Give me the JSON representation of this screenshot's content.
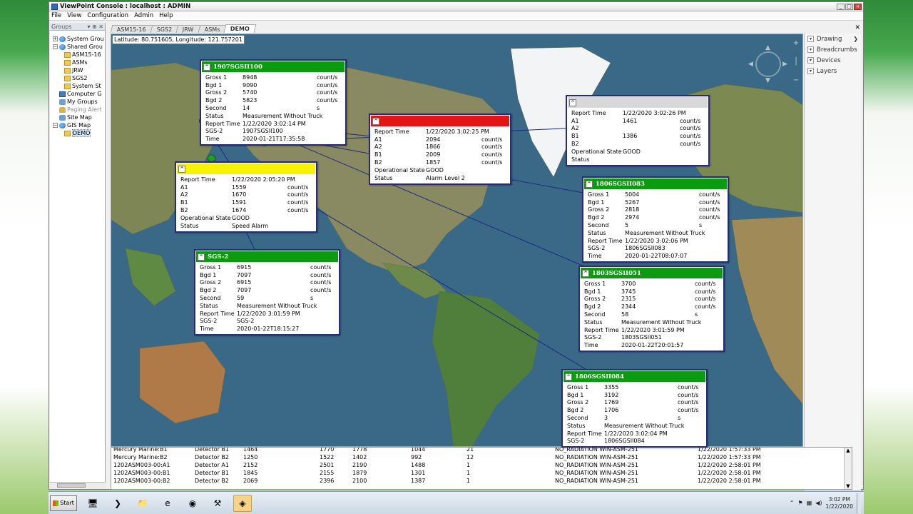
{
  "window": {
    "title": "ViewPoint Console : localhost : ADMIN"
  },
  "menu": [
    "File",
    "View",
    "Configuration",
    "Admin",
    "Help"
  ],
  "groups_panel": {
    "title": "Groups",
    "controls": "▾ ⊕ ✕",
    "items": [
      {
        "label": "System Grou",
        "icon": "globe-icon",
        "indent": 0,
        "expander": "+"
      },
      {
        "label": "Shared Grou",
        "icon": "globe-icon",
        "indent": 0,
        "expander": "−"
      },
      {
        "label": "ASM15-16",
        "icon": "folder-icon",
        "indent": 1
      },
      {
        "label": "ASMs",
        "icon": "folder-icon",
        "indent": 1
      },
      {
        "label": "JRW",
        "icon": "folder-icon",
        "indent": 1
      },
      {
        "label": "SGS2",
        "icon": "folder-icon",
        "indent": 1
      },
      {
        "label": "System St",
        "icon": "folder-icon",
        "indent": 1
      },
      {
        "label": "Computer G",
        "icon": "monitor-icon",
        "indent": 0
      },
      {
        "label": "My Groups",
        "icon": "groups-icon",
        "indent": 0
      },
      {
        "label": "Paging Alert",
        "icon": "bell-icon",
        "indent": 0,
        "dim": true
      },
      {
        "label": "Site Map",
        "icon": "groups-icon",
        "indent": 0
      },
      {
        "label": "GIS Map",
        "icon": "globe-icon",
        "indent": 0,
        "expander": "−"
      },
      {
        "label": "DEMO",
        "icon": "folder-icon",
        "indent": 1,
        "selected": true
      }
    ]
  },
  "tabs": [
    {
      "label": "ASM15-16"
    },
    {
      "label": "SGS2"
    },
    {
      "label": "JRW"
    },
    {
      "label": "ASMs"
    },
    {
      "label": "DEMO",
      "active": true
    }
  ],
  "tab_close": "✕",
  "map": {
    "coordinates": "Latitude: 80.751605, Longitude: 121.757201",
    "points": [
      {
        "lat": 47.5,
        "lon": -122.0
      },
      {
        "lat": 47.5,
        "lon": -112.0
      },
      {
        "lat": 45.5,
        "lon": -93.0
      },
      {
        "lat": 39.5,
        "lon": -90.0
      },
      {
        "lat": 40.5,
        "lon": -75.0
      },
      {
        "lat": 40.0,
        "lon": -77.0
      },
      {
        "lat": 33.5,
        "lon": -117.5
      },
      {
        "lat": 27.5,
        "lon": -93.0
      }
    ]
  },
  "popups": [
    {
      "id": "1907",
      "title": "1907SGSII100",
      "color": "green",
      "anchor": 2,
      "rows": [
        [
          "Gross 1",
          "8948",
          "count/s"
        ],
        [
          "Bgd 1",
          "9090",
          "count/s"
        ],
        [
          "Gross 2",
          "5740",
          "count/s"
        ],
        [
          "Bgd 2",
          "5823",
          "count/s"
        ],
        [
          "Second",
          "14",
          "s"
        ],
        [
          "Status",
          "Measurement Without Truck",
          ""
        ],
        [
          "Report Time",
          "1/22/2020 3:02:14 PM",
          ""
        ],
        [
          "SGS-2",
          "1907SGSII100",
          ""
        ],
        [
          "Time",
          "2020-01-21T17:35:58",
          ""
        ]
      ]
    },
    {
      "id": "yellow",
      "title": "",
      "color": "yellow",
      "anchor": 0,
      "rows": [
        [
          "Report Time",
          "1/22/2020 2:05:20 PM",
          ""
        ],
        [
          "A1",
          "1559",
          "count/s"
        ],
        [
          "A2",
          "1670",
          "count/s"
        ],
        [
          "B1",
          "1591",
          "count/s"
        ],
        [
          "B2",
          "1674",
          "count/s"
        ],
        [
          "Operational State",
          "GOOD",
          ""
        ],
        [
          "Status",
          "Speed Alarm",
          ""
        ]
      ]
    },
    {
      "id": "red",
      "title": "",
      "color": "red",
      "anchor": 1,
      "rows": [
        [
          "Report Time",
          "1/22/2020 3:02:25 PM",
          ""
        ],
        [
          "A1",
          "2094",
          "count/s"
        ],
        [
          "A2",
          "1866",
          "count/s"
        ],
        [
          "B1",
          "2009",
          "count/s"
        ],
        [
          "B2",
          "1857",
          "count/s"
        ],
        [
          "Operational State",
          "GOOD",
          ""
        ],
        [
          "Status",
          "Alarm Level 2",
          ""
        ]
      ]
    },
    {
      "id": "gray",
      "title": "",
      "color": "gray",
      "anchor": 3,
      "rows": [
        [
          "Report Time",
          "1/22/2020 3:02:26 PM",
          ""
        ],
        [
          "A1",
          "1461",
          "count/s"
        ],
        [
          "A2",
          "",
          "count/s"
        ],
        [
          "B1",
          "1386",
          "count/s"
        ],
        [
          "B2",
          "",
          "count/s"
        ],
        [
          "Operational State",
          "GOOD",
          ""
        ],
        [
          "Status",
          "",
          ""
        ]
      ]
    },
    {
      "id": "1806083",
      "title": "1806SGSII083",
      "color": "green",
      "anchor": 4,
      "rows": [
        [
          "Gross 1",
          "5004",
          "count/s"
        ],
        [
          "Bgd 1",
          "5267",
          "count/s"
        ],
        [
          "Gross 2",
          "2818",
          "count/s"
        ],
        [
          "Bgd 2",
          "2974",
          "count/s"
        ],
        [
          "Second",
          "5",
          "s"
        ],
        [
          "Status",
          "Measurement Without Truck",
          ""
        ],
        [
          "Report Time",
          "1/22/2020 3:02:06 PM",
          ""
        ],
        [
          "SGS-2",
          "1806SGSII083",
          ""
        ],
        [
          "Time",
          "2020-01-22T08:07:07",
          ""
        ]
      ]
    },
    {
      "id": "sgs2",
      "title": "SGS-2",
      "color": "green",
      "anchor": 6,
      "rows": [
        [
          "Gross 1",
          "6915",
          "count/s"
        ],
        [
          "Bgd 1",
          "7097",
          "count/s"
        ],
        [
          "Gross 2",
          "6915",
          "count/s"
        ],
        [
          "Bgd 2",
          "7097",
          "count/s"
        ],
        [
          "Second",
          "59",
          "s"
        ],
        [
          "Status",
          "Measurement Without Truck",
          ""
        ],
        [
          "Report Time",
          "1/22/2020 3:01:59 PM",
          ""
        ],
        [
          "SGS-2",
          "SGS-2",
          ""
        ],
        [
          "Time",
          "2020-01-22T18:15:27",
          ""
        ]
      ]
    },
    {
      "id": "1803",
      "title": "1803SGSII051",
      "color": "green",
      "anchor": 5,
      "rows": [
        [
          "Gross 1",
          "3700",
          "count/s"
        ],
        [
          "Bgd 1",
          "3745",
          "count/s"
        ],
        [
          "Gross 2",
          "2315",
          "count/s"
        ],
        [
          "Bgd 2",
          "2344",
          "count/s"
        ],
        [
          "Second",
          "58",
          "s"
        ],
        [
          "Status",
          "Measurement Without Truck",
          ""
        ],
        [
          "Report Time",
          "1/22/2020 3:01:59 PM",
          ""
        ],
        [
          "SGS-2",
          "1803SGSII051",
          ""
        ],
        [
          "Time",
          "2020-01-22T20:01:57",
          ""
        ]
      ]
    },
    {
      "id": "1806084",
      "title": "1806SGSII084",
      "color": "green",
      "anchor": 7,
      "rows": [
        [
          "Gross 1",
          "3355",
          "count/s"
        ],
        [
          "Bgd 1",
          "3192",
          "count/s"
        ],
        [
          "Gross 2",
          "1769",
          "count/s"
        ],
        [
          "Bgd 2",
          "1706",
          "count/s"
        ],
        [
          "Second",
          "3",
          "s"
        ],
        [
          "Status",
          "Measurement Without Truck",
          ""
        ],
        [
          "Report Time",
          "1/22/2020 3:02:04 PM",
          ""
        ],
        [
          "SGS-2",
          "1806SGSII084",
          ""
        ]
      ]
    }
  ],
  "right_panel": {
    "items": [
      "Drawing",
      "Breadcrumbs",
      "Devices",
      "Layers"
    ],
    "pin": "❯"
  },
  "grid": {
    "rows": [
      [
        "Mercury Marine:B1",
        "Detector B1",
        "1464",
        "1770",
        "1778",
        "1044",
        "21",
        "NO_RADIATION WIN-ASM-251",
        "1/22/2020 1:57:33 PM"
      ],
      [
        "Mercury Marine:B2",
        "Detector B2",
        "1250",
        "1522",
        "1402",
        "992",
        "12",
        "NO_RADIATION WIN-ASM-251",
        "1/22/2020 1:57:33 PM"
      ],
      [
        "1202ASM003-00:A1",
        "Detector A1",
        "2152",
        "2501",
        "2190",
        "1488",
        "1",
        "NO_RADIATION WIN-ASM-251",
        "1/22/2020 2:58:01 PM"
      ],
      [
        "1202ASM003-00:B1",
        "Detector B1",
        "1845",
        "2155",
        "1879",
        "1301",
        "1",
        "NO_RADIATION WIN-ASM-251",
        "1/22/2020 2:58:01 PM"
      ],
      [
        "1202ASM003-00:B2",
        "Detector B2",
        "2069",
        "2396",
        "2100",
        "1387",
        "1",
        "NO_RADIATION WIN-ASM-251",
        "1/22/2020 2:58:01 PM"
      ]
    ]
  },
  "taskbar": {
    "start_label": "Start",
    "icons": [
      "server-manager-icon",
      "powershell-icon",
      "explorer-icon",
      "ie-icon",
      "firefox-icon",
      "tools-icon",
      "viewpoint-icon"
    ],
    "clock_time": "3:02 PM",
    "clock_date": "1/22/2020"
  }
}
